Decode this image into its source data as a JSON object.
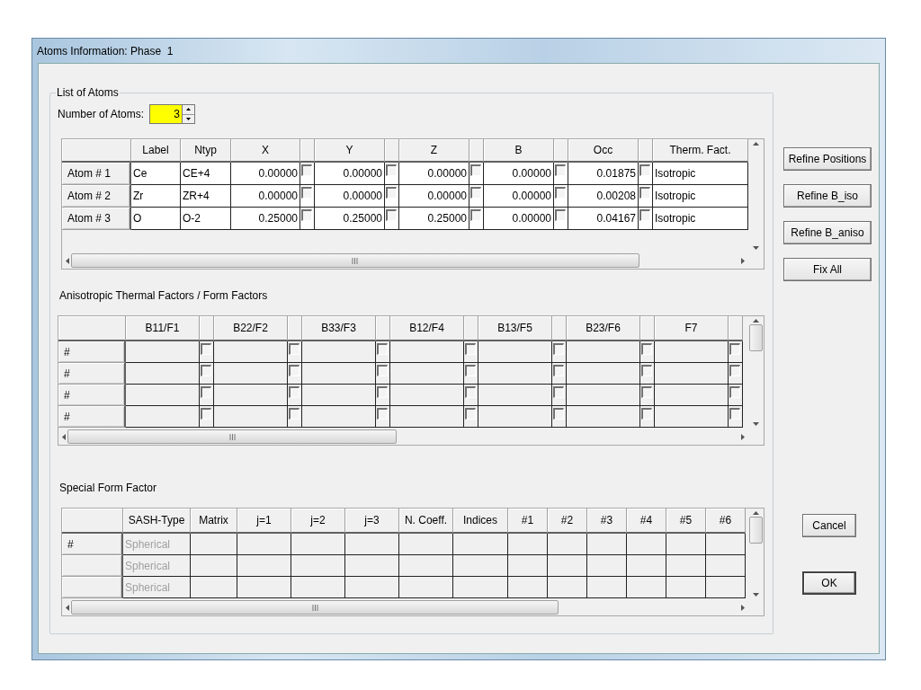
{
  "window": {
    "title": "Atoms Information: Phase  1"
  },
  "list_of_atoms": {
    "title": "List of Atoms",
    "number_of_atoms": {
      "label": "Number of Atoms:",
      "value": "3"
    }
  },
  "atoms_table": {
    "columns": [
      "Label",
      "Ntyp",
      "X",
      "Y",
      "Z",
      "B",
      "Occ",
      "Therm. Fact."
    ],
    "rows": [
      {
        "header": "Atom # 1",
        "label": "Ce",
        "ntyp": "CE+4",
        "params": [
          {
            "value": "0.00000",
            "checked": false
          },
          {
            "value": "0.00000",
            "checked": false
          },
          {
            "value": "0.00000",
            "checked": false
          },
          {
            "value": "0.00000",
            "checked": false
          },
          {
            "value": "0.01875",
            "checked": false
          }
        ],
        "therm": "Isotropic"
      },
      {
        "header": "Atom # 2",
        "label": "Zr",
        "ntyp": "ZR+4",
        "params": [
          {
            "value": "0.00000",
            "checked": false
          },
          {
            "value": "0.00000",
            "checked": false
          },
          {
            "value": "0.00000",
            "checked": false
          },
          {
            "value": "0.00000",
            "checked": false
          },
          {
            "value": "0.00208",
            "checked": false
          }
        ],
        "therm": "Isotropic"
      },
      {
        "header": "Atom # 3",
        "label": "O",
        "ntyp": "O-2",
        "params": [
          {
            "value": "0.25000",
            "checked": false
          },
          {
            "value": "0.25000",
            "checked": false
          },
          {
            "value": "0.25000",
            "checked": false
          },
          {
            "value": "0.00000",
            "checked": false
          },
          {
            "value": "0.04167",
            "checked": false
          }
        ],
        "therm": "Isotropic"
      }
    ]
  },
  "anisotropic": {
    "title": "Anisotropic Thermal Factors / Form Factors",
    "columns": [
      "B11/F1",
      "B22/F2",
      "B33/F3",
      "B12/F4",
      "B13/F5",
      "B23/F6",
      "F7"
    ],
    "rows": [
      {
        "header": "#",
        "checked": [
          false,
          false,
          false,
          false,
          false,
          false,
          false
        ]
      },
      {
        "header": "#",
        "checked": [
          false,
          false,
          false,
          false,
          false,
          false,
          false
        ]
      },
      {
        "header": "#",
        "checked": [
          false,
          false,
          false,
          false,
          false,
          false,
          false
        ]
      },
      {
        "header": "#",
        "checked": [
          false,
          false,
          false,
          false,
          false,
          false,
          false
        ]
      }
    ]
  },
  "special_form_factor": {
    "title": "Special Form Factor",
    "columns": [
      "SASH-Type",
      "Matrix",
      "j=1",
      "j=2",
      "j=3",
      "N. Coeff.",
      "Indices",
      "#1",
      "#2",
      "#3",
      "#4",
      "#5",
      "#6"
    ],
    "rows": [
      {
        "header": "#",
        "sash_type": "Spherical",
        "disabled": true
      },
      {
        "sash_type": "Spherical",
        "disabled": true
      },
      {
        "sash_type": "Spherical",
        "disabled": true
      }
    ]
  },
  "side_buttons": [
    "Refine Positions",
    "Refine B_iso",
    "Refine B_aniso",
    "Fix All"
  ],
  "buttons": [
    "Cancel",
    "OK"
  ]
}
